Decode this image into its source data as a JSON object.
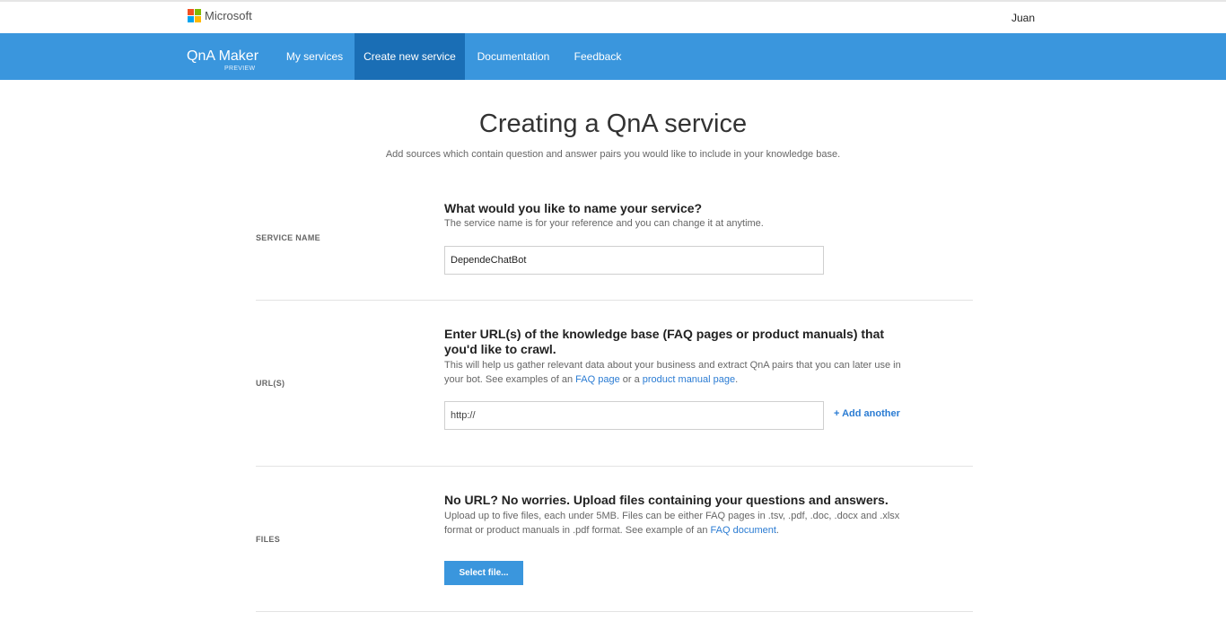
{
  "header": {
    "brand_logo_text": "Microsoft",
    "user_name": "Juan"
  },
  "nav": {
    "app_name": "QnA Maker",
    "app_badge": "PREVIEW",
    "items": [
      {
        "label": "My services"
      },
      {
        "label": "Create new service",
        "active": true
      },
      {
        "label": "Documentation"
      },
      {
        "label": "Feedback"
      }
    ]
  },
  "page": {
    "title": "Creating a QnA service",
    "subtitle": "Add sources which contain question and answer pairs you would like to include in your knowledge base."
  },
  "sections": {
    "service_name": {
      "label": "SERVICE NAME",
      "question": "What would you like to name your service?",
      "description": "The service name is for your reference and you can change it at anytime.",
      "input_value": "DependeChatBot"
    },
    "urls": {
      "label": "URL(S)",
      "question": "Enter URL(s) of the knowledge base (FAQ pages or product manuals) that you'd like to crawl.",
      "description_pre": "This will help us gather relevant data about your business and extract QnA pairs that you can later use in your bot. See examples of an ",
      "faq_link": "FAQ page",
      "description_mid": " or a ",
      "manual_link": "product manual page",
      "description_post": ".",
      "input_placeholder": "http://",
      "add_another": "+ Add another"
    },
    "files": {
      "label": "FILES",
      "question": "No URL? No worries. Upload files containing your questions and answers.",
      "description_pre": "Upload up to five files, each under 5MB. Files can be either FAQ pages in .tsv, .pdf, .doc, .docx and .xlsx format or product manuals in .pdf format. See example of an ",
      "faq_doc_link": "FAQ document",
      "description_post": ".",
      "select_button": "Select file..."
    }
  },
  "colors": {
    "nav_bg": "#3a96dd",
    "nav_active_bg": "#1a6eb5",
    "link": "#2b7cd3"
  }
}
